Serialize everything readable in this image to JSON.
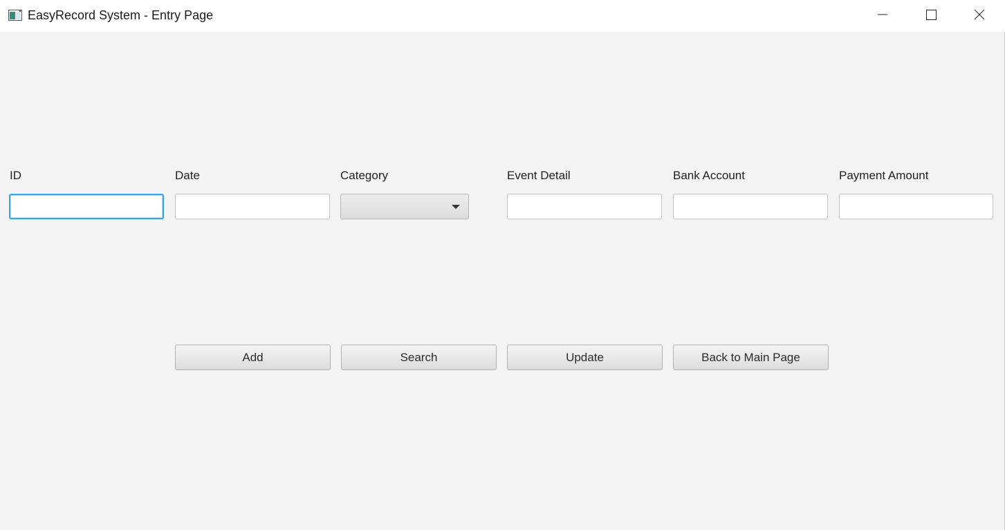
{
  "window": {
    "title": "EasyRecord System - Entry Page",
    "icons": {
      "app": "app-window-icon",
      "minimize": "minimize-icon",
      "maximize": "maximize-icon",
      "close": "close-icon"
    }
  },
  "form": {
    "fields": {
      "id": {
        "label": "ID",
        "value": ""
      },
      "date": {
        "label": "Date",
        "value": ""
      },
      "category": {
        "label": "Category",
        "value": ""
      },
      "event_detail": {
        "label": "Event Detail",
        "value": ""
      },
      "bank_account": {
        "label": "Bank Account",
        "value": ""
      },
      "payment_amount": {
        "label": "Payment Amount",
        "value": ""
      }
    }
  },
  "actions": {
    "add": "Add",
    "search": "Search",
    "update": "Update",
    "back": "Back to Main Page"
  },
  "colors": {
    "background": "#f3f3f3",
    "focus_ring": "#3aa3e3"
  }
}
